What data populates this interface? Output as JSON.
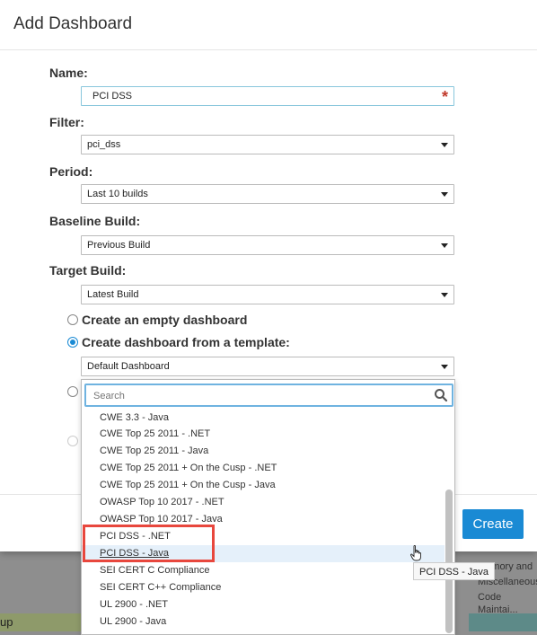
{
  "background": {
    "left_strip_text": "up",
    "right_lines": [
      "Memory and",
      "Miscellaneous",
      "Code Maintai..."
    ]
  },
  "dialog": {
    "title": "Add Dashboard",
    "name": {
      "label": "Name:",
      "value": "PCI DSS",
      "required_mark": "*"
    },
    "filter": {
      "label": "Filter:",
      "value": "pci_dss"
    },
    "period": {
      "label": "Period:",
      "value": "Last 10 builds"
    },
    "baseline": {
      "label": "Baseline Build:",
      "value": "Previous Build"
    },
    "target": {
      "label": "Target Build:",
      "value": "Latest Build"
    },
    "options": {
      "empty_label": "Create an empty dashboard",
      "template_label": "Create dashboard from a template:"
    },
    "template_select": {
      "value": "Default Dashboard"
    },
    "create_label": "Create"
  },
  "dropdown": {
    "search_placeholder": "Search",
    "items": [
      "CWE 3.3 - Java",
      "CWE Top 25 2011 - .NET",
      "CWE Top 25 2011 - Java",
      "CWE Top 25 2011 + On the Cusp - .NET",
      "CWE Top 25 2011 + On the Cusp - Java",
      "OWASP Top 10 2017 - .NET",
      "OWASP Top 10 2017 - Java",
      "PCI DSS - .NET",
      "PCI DSS - Java",
      "SEI CERT C Compliance",
      "SEI CERT C++ Compliance",
      "UL 2900 - .NET",
      "UL 2900 - Java"
    ],
    "hovered_item": "PCI DSS - Java"
  },
  "tooltip": "PCI DSS - Java",
  "colors": {
    "accent": "#1a8ad4",
    "highlight": "#e8473d",
    "required": "#c0392b"
  }
}
